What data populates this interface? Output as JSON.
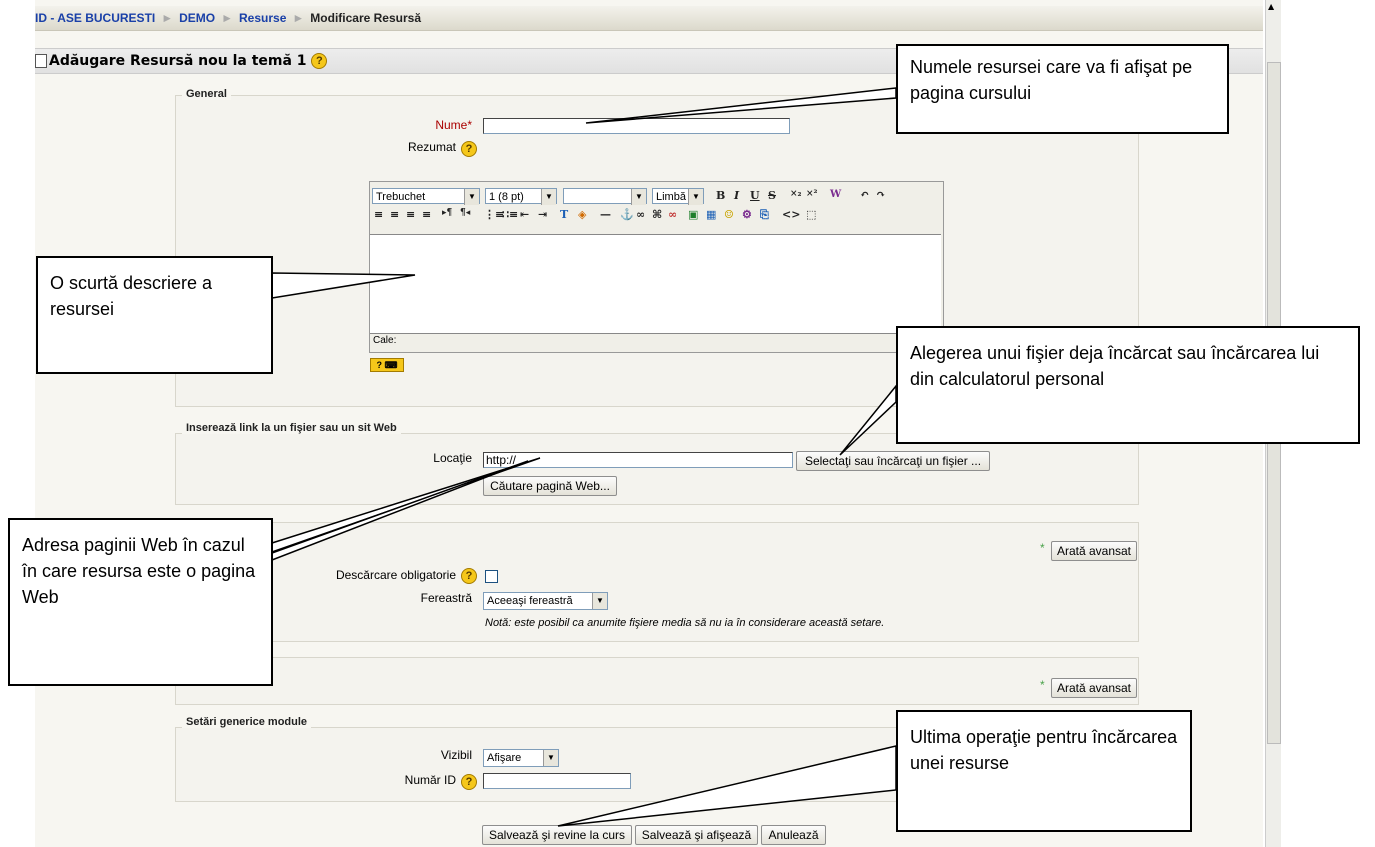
{
  "breadcrumb": {
    "items": [
      "ID - ASE BUCURESTI",
      "DEMO",
      "Resurse"
    ],
    "current": "Modificare Resursă",
    "separator": "►"
  },
  "heading": "Adăugare Resursă nou la temă 1",
  "sections": {
    "general": {
      "legend": "General",
      "name_label": "Nume",
      "required_mark": "*",
      "name_value": "",
      "summary_label": "Rezumat",
      "path_label": "Cale:"
    },
    "editor": {
      "font": "Trebuchet",
      "size": "1 (8 pt)",
      "format": "",
      "lang": "Limbă"
    },
    "link": {
      "legend": "Inserează link la un fişier sau un sit Web",
      "location_label": "Locaţie",
      "location_value": "http://",
      "choose_button": "Selectaţi sau încărcaţi un fişier ...",
      "search_button": "Căutare pagină Web..."
    },
    "window": {
      "advanced_button": "Arată avansat",
      "force_download_label": "Descărcare obligatorie",
      "window_label": "Fereastră",
      "window_value": "Aceeaşi fereastră",
      "note": "Notă: este posibil ca anumite fişiere media să nu ia în considerare această setare."
    },
    "params": {
      "advanced_button": "Arată avansat"
    },
    "common": {
      "legend": "Setări generice module",
      "visible_label": "Vizibil",
      "visible_value": "Afişare",
      "idnumber_label": "Număr ID"
    }
  },
  "buttons": {
    "save_return": "Salvează şi revine la curs",
    "save_display": "Salvează şi afişează",
    "cancel": "Anulează"
  },
  "callouts": {
    "name": "Numele resursei care va fi afişat pe pagina cursului",
    "summary": "O scurtă descriere a resursei",
    "file": "Alegerea unui fişier deja încărcat sau încărcarea lui din calculatorul personal",
    "web": "Adresa paginii Web în cazul în care resursa este o pagina Web",
    "save": "Ultima operaţie pentru încărcarea unei resurse"
  },
  "colors": {
    "link": "#1a40a8",
    "required": "#aa0000",
    "help_icon": "#f5c71a"
  }
}
